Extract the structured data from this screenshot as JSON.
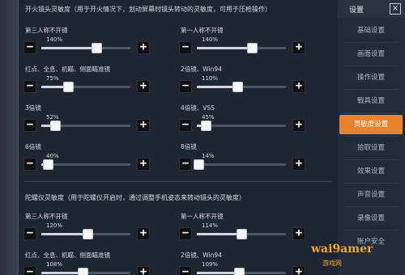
{
  "panel": {
    "section1_title": "开火镜头灵敏度（用于开火情况下，划动屏幕时镜头转动的灵敏度，可用于压枪操作）",
    "section2_title": "陀螺仪灵敏度（用于陀螺仪开启时，通过调整手机姿态来转动镜头的灵敏度）",
    "fire_controls": [
      {
        "label": "第三人称不开镜",
        "value": "140%",
        "level": 0.62
      },
      {
        "label": "第一人称不开镜",
        "value": "140%",
        "level": 0.62
      },
      {
        "label": "红点、全息、机瞄、侧面瞄准镜",
        "value": "75%",
        "level": 0.3
      },
      {
        "label": "2倍镜、Win94",
        "value": "110%",
        "level": 0.45
      },
      {
        "label": "3倍镜",
        "value": "52%",
        "level": 0.15
      },
      {
        "label": "4倍镜、VSS",
        "value": "45%",
        "level": 0.1
      },
      {
        "label": "6倍镜",
        "value": "40%",
        "level": 0.07
      },
      {
        "label": "8倍镜",
        "value": "14%",
        "level": 0.02
      }
    ],
    "gyro_controls": [
      {
        "label": "第三人称不开镜",
        "value": "120%",
        "level": 0.52
      },
      {
        "label": "第一人称不开镜",
        "value": "114%",
        "level": 0.5
      },
      {
        "label": "红点、全息、机瞄、侧面瞄准镜",
        "value": "108%",
        "level": 0.46
      },
      {
        "label": "2倍镜、Win94",
        "value": "109%",
        "level": 0.47
      }
    ],
    "minus_symbol": "−",
    "plus_symbol": "+"
  },
  "sidebar": {
    "title": "设置",
    "close": "×",
    "items": [
      {
        "label": "基础设置",
        "active": false
      },
      {
        "label": "画面设置",
        "active": false
      },
      {
        "label": "操作设置",
        "active": false
      },
      {
        "label": "戰具设置",
        "active": false
      },
      {
        "label": "灵敏度设置",
        "active": true
      },
      {
        "label": "拾取设置",
        "active": false
      },
      {
        "label": "效果设置",
        "active": false
      },
      {
        "label": "声音设置",
        "active": false
      },
      {
        "label": "录像设置",
        "active": false
      },
      {
        "label": "账户安全",
        "active": false
      }
    ]
  },
  "watermark": {
    "text": "wai9amer",
    "sub": "游戏网"
  },
  "colors": {
    "accent": "#e8822c",
    "background": "#1e2632"
  }
}
